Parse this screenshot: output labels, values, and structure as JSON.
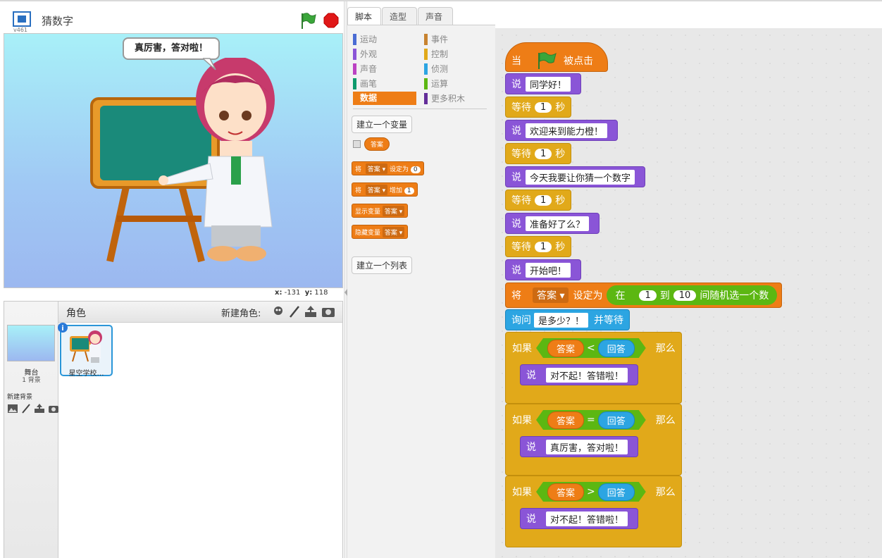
{
  "project": {
    "title": "猜数字",
    "version": "v461"
  },
  "stage": {
    "speech": "真厉害，答对啦！",
    "mouse_x_label": "x:",
    "mouse_x": "-131",
    "mouse_y_label": "y:",
    "mouse_y": "118"
  },
  "sprites_pane": {
    "header_label": "角色",
    "new_sprite_label": "新建角色:",
    "stage_name": "舞台",
    "stage_backdrops": "1 背景",
    "new_backdrop_label": "新建背景",
    "sprite_name": "星空学校…"
  },
  "tabs": [
    "脚本",
    "造型",
    "声音"
  ],
  "categories": [
    {
      "label": "运动",
      "color": "#4a6cd4"
    },
    {
      "label": "外观",
      "color": "#8a55d7"
    },
    {
      "label": "声音",
      "color": "#bb42c3"
    },
    {
      "label": "画笔",
      "color": "#0e9a6c"
    },
    {
      "label": "数据",
      "color": "#ee7d16"
    },
    {
      "label": "事件",
      "color": "#c88330"
    },
    {
      "label": "控制",
      "color": "#e1a91a"
    },
    {
      "label": "侦测",
      "color": "#2ca5e2"
    },
    {
      "label": "运算",
      "color": "#5cb712"
    },
    {
      "label": "更多积木",
      "color": "#632d99"
    }
  ],
  "palette": {
    "make_variable": "建立一个变量",
    "variable_name": "答案",
    "set_block": {
      "prefix": "将",
      "var": "答案",
      "mid": "设定为",
      "val": "0"
    },
    "change_block": {
      "prefix": "将",
      "var": "答案",
      "mid": "增加",
      "val": "1"
    },
    "show_block": {
      "label": "显示变量",
      "var": "答案"
    },
    "hide_block": {
      "label": "隐藏变量",
      "var": "答案"
    },
    "make_list": "建立一个列表"
  },
  "script": {
    "hat": {
      "prefix": "当",
      "suffix": "被点击"
    },
    "say_label": "说",
    "wait_label": "等待",
    "wait_unit": "秒",
    "wait_value": "1",
    "says": [
      "同学好！",
      "欢迎来到能力橙！",
      "今天我要让你猜一个数字",
      "准备好了么？",
      "开始吧！"
    ],
    "set": {
      "prefix": "将",
      "var": "答案",
      "mid": "设定为",
      "op_pre": "在",
      "from": "1",
      "to_word": "到",
      "to": "10",
      "op_suf": "间随机选一个数"
    },
    "ask": {
      "prefix": "询问",
      "question": "是多少？！",
      "suffix": "并等待"
    },
    "if_label": "如果",
    "then_label": "那么",
    "ifs": [
      {
        "left": "答案",
        "op": "<",
        "right": "回答",
        "say": "对不起！答错啦！"
      },
      {
        "left": "答案",
        "op": "=",
        "right": "回答",
        "say": "真厉害，答对啦！"
      },
      {
        "left": "答案",
        "op": ">",
        "right": "回答",
        "say": "对不起！答错啦！"
      }
    ]
  }
}
